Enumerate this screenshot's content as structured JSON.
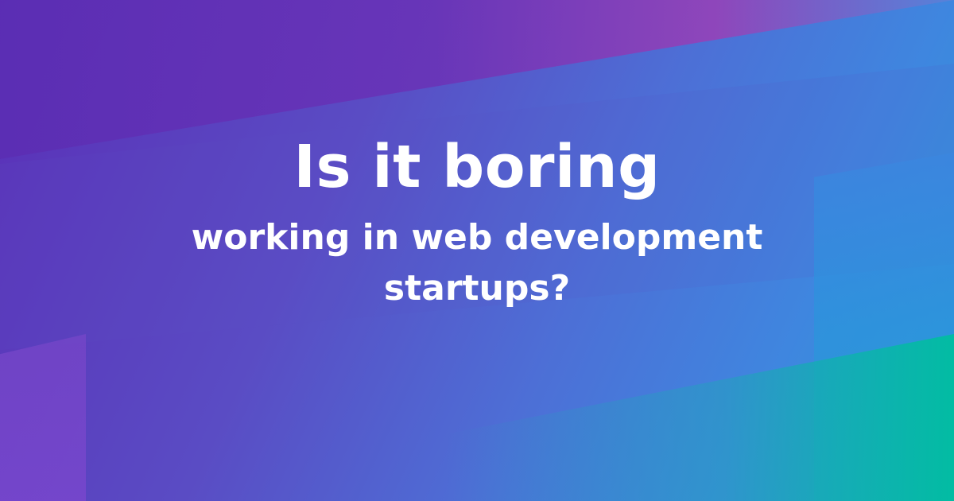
{
  "hero": {
    "title": "Is it boring",
    "subtitle_line1": "working in web development",
    "subtitle_line2": "startups?"
  },
  "colors": {
    "background_start": "#5a2fb7",
    "background_mid": "#4d6fd6",
    "background_end": "#2a9cd8",
    "accent_teal": "#00bea0",
    "text": "#ffffff"
  }
}
